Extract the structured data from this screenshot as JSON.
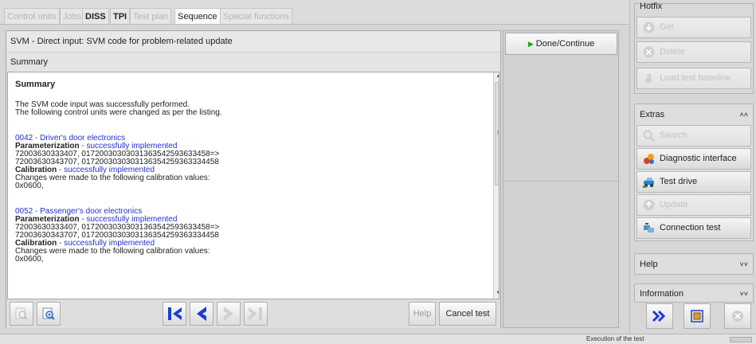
{
  "tabs": [
    {
      "label": "Control units",
      "state": "disabled"
    },
    {
      "label": "Jobs",
      "state": "disabled"
    },
    {
      "label": "DISS",
      "state": "bold"
    },
    {
      "label": "TPI",
      "state": "bold"
    },
    {
      "label": "Test plan",
      "state": "disabled"
    },
    {
      "label": "Sequence",
      "state": "active"
    },
    {
      "label": "Special functions",
      "state": "disabled"
    }
  ],
  "main": {
    "title": "SVM - Direct input: SVM code for problem-related update",
    "subtitle": "Summary",
    "content": {
      "heading": "Summary",
      "intro1": "The SVM code input was successfully performed.",
      "intro2": "The following control units were changed as per the listing.",
      "units": [
        {
          "name": "0042 - Driver's door electronics",
          "param_label": "Parameterization",
          "param_status": " - successfully implemented",
          "param_line1": "72003630333407, 01720030303031363542593633458=>",
          "param_line2": "72003630343707, 0172003030303136354259363334458",
          "calib_label": "Calibration",
          "calib_status": " - successfully implemented",
          "changes": "Changes were made to the following calibration values:",
          "value": "0x0600,"
        },
        {
          "name": "0052 - Passenger's door electronics",
          "param_label": "Parameterization",
          "param_status": " - successfully implemented",
          "param_line1": "72003630333407, 01720030303031363542593633458=>",
          "param_line2": "72003630343707, 0172003030303136354259363334458",
          "calib_label": "Calibration",
          "calib_status": " - successfully implemented",
          "changes": "Changes were made to the following calibration values:",
          "value": "0x0600,"
        }
      ]
    },
    "toolbar": {
      "help_label": "Help",
      "cancel_label": "Cancel test"
    }
  },
  "middle": {
    "done_label": "Done/Continue"
  },
  "right": {
    "hotfix": {
      "title": "Hotfix",
      "buttons": [
        {
          "label": "Get",
          "icon": "download-icon"
        },
        {
          "label": "Delete",
          "icon": "delete-icon"
        },
        {
          "label": "Load test baseline",
          "icon": "load-baseline-icon"
        }
      ]
    },
    "extras": {
      "title": "Extras",
      "buttons": [
        {
          "label": "Search",
          "icon": "search-icon"
        },
        {
          "label": "Diagnostic interface",
          "icon": "diagnostic-interface-icon"
        },
        {
          "label": "Test drive",
          "icon": "test-drive-icon"
        },
        {
          "label": "Update",
          "icon": "update-icon"
        },
        {
          "label": "Connection test",
          "icon": "connection-test-icon"
        }
      ]
    },
    "help_title": "Help",
    "information_title": "Information"
  },
  "status": {
    "text": "Execution of the test"
  },
  "colors": {
    "link_blue": "#2530c8",
    "nav_blue": "#1c3fd0"
  }
}
